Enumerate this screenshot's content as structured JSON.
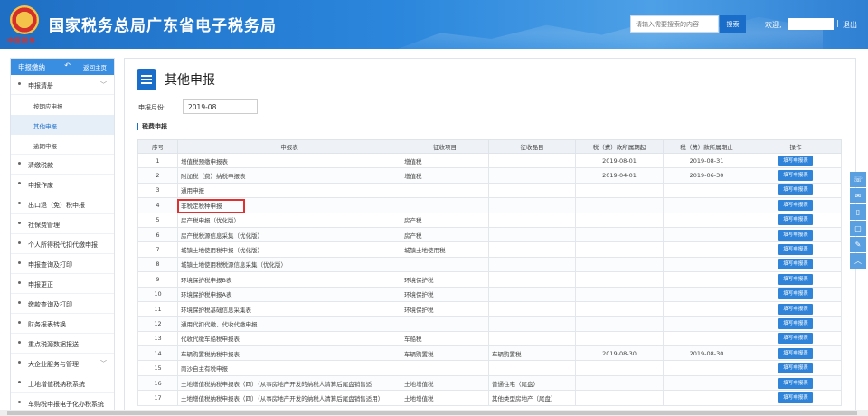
{
  "header": {
    "emblem_text": "中国税务",
    "title": "国家税务总局广东省电子税务局",
    "search_placeholder": "请输入需要搜索的内容",
    "search_button": "搜索",
    "welcome": "欢迎,",
    "separator": "|",
    "logout": "退出"
  },
  "sidebar": {
    "title": "申报缴纳",
    "back": "返回主页",
    "items": [
      {
        "label": "申报清册",
        "chevron": "﹀"
      },
      {
        "label": "按期应申报"
      },
      {
        "label": "其他申报"
      },
      {
        "label": "逾期申报"
      },
      {
        "label": "清缴税款"
      },
      {
        "label": "申报作废"
      },
      {
        "label": "出口退（免）税申报"
      },
      {
        "label": "社保费管理"
      },
      {
        "label": "个人所得税代扣代缴申报"
      },
      {
        "label": "申报查询及打印"
      },
      {
        "label": "申报更正"
      },
      {
        "label": "缴款查询及打印"
      },
      {
        "label": "财务报表转换"
      },
      {
        "label": "重点税源数据报送"
      },
      {
        "label": "大企业服务与管理",
        "chevron": "﹀"
      },
      {
        "label": "土地增值税纳税系统"
      },
      {
        "label": "车购税申报电子化办税系统"
      }
    ]
  },
  "main": {
    "title": "其他申报",
    "month_label": "申报月份:",
    "month_value": "2019-08",
    "section": "税费申报",
    "columns": [
      "序号",
      "申报表",
      "征收项目",
      "征收品目",
      "税（费）款所属期起",
      "税（费）款所属期止",
      "操作"
    ],
    "action_label": "填写申报表",
    "rows": [
      [
        "1",
        "增值税预缴申报表",
        "增值税",
        "",
        "2019-08-01",
        "2019-08-31"
      ],
      [
        "2",
        "附加税（费）纳税申报表",
        "增值税",
        "",
        "2019-04-01",
        "2019-06-30"
      ],
      [
        "3",
        "通用申报",
        "",
        "",
        "",
        ""
      ],
      [
        "4",
        "非税定税种申报",
        "",
        "",
        "",
        ""
      ],
      [
        "5",
        "房产税申报（优化版）",
        "房产税",
        "",
        "",
        ""
      ],
      [
        "6",
        "房产税税源信息采集（优化版）",
        "房产税",
        "",
        "",
        ""
      ],
      [
        "7",
        "城镇土地使用税申报（优化版）",
        "城镇土地使用税",
        "",
        "",
        ""
      ],
      [
        "8",
        "城镇土地使用税税源信息采集（优化版）",
        "",
        "",
        "",
        ""
      ],
      [
        "9",
        "环境保护税申报B表",
        "环境保护税",
        "",
        "",
        ""
      ],
      [
        "10",
        "环境保护税申报A表",
        "环境保护税",
        "",
        "",
        ""
      ],
      [
        "11",
        "环境保护税基础信息采集表",
        "环境保护税",
        "",
        "",
        ""
      ],
      [
        "12",
        "通用代扣代缴、代收代缴申报",
        "",
        "",
        "",
        ""
      ],
      [
        "13",
        "代收代缴车船税申报表",
        "车船税",
        "",
        "",
        ""
      ],
      [
        "14",
        "车辆购置税纳税申报表",
        "车辆购置税",
        "车辆购置税",
        "2019-08-30",
        "2019-08-30"
      ],
      [
        "15",
        "南沙自主有税申报",
        "",
        "",
        "",
        ""
      ],
      [
        "16",
        "土地增值税纳税申报表（四）（从事房地产开发的纳税人清算后尾盘销售适",
        "土地增值税",
        "普通住宅（尾盘）",
        "",
        ""
      ],
      [
        "17",
        "土地增值税纳税申报表（四）（从事房地产开发的纳税人清算后尾盘销售适用）",
        "土地增值税",
        "其他类型房地产（尾盘）",
        "",
        ""
      ]
    ]
  },
  "float_bar": {
    "buttons": [
      "☏",
      "✉",
      "▯",
      "▢",
      "✎",
      "︿"
    ]
  }
}
